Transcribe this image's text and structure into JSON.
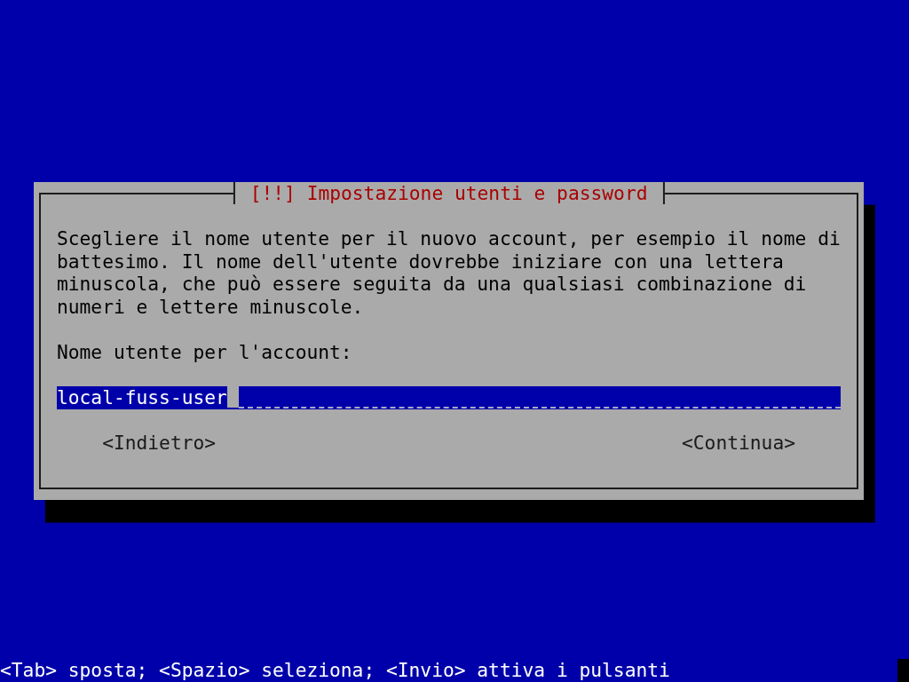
{
  "dialog": {
    "title": "[!!] Impostazione utenti e password",
    "description": "Scegliere il nome utente per il nuovo account, per esempio il nome di battesimo. Il nome dell'utente dovrebbe iniziare con una lettera minuscola, che può essere seguita da una qualsiasi combinazione di numeri e lettere minuscole.",
    "field": {
      "label": "Nome utente per l'account:",
      "value": "local-fuss-user",
      "focused": true
    },
    "buttons": [
      "<Indietro>",
      "<Continua>"
    ]
  },
  "status_bar": {
    "text": "<Tab> sposta; <Spazio> seleziona; <Invio> attiva i pulsanti"
  }
}
